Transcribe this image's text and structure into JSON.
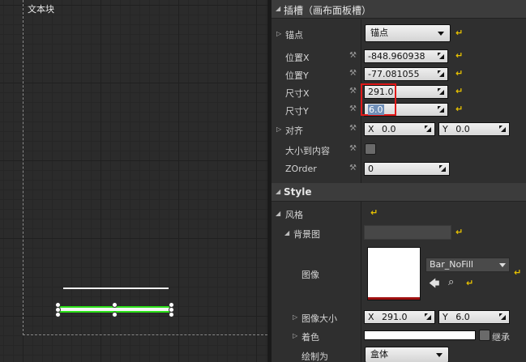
{
  "viewport": {
    "label": "文本块"
  },
  "panel": {
    "section_slot": {
      "title": "插槽（画布面板槽）"
    },
    "anchor": {
      "label": "锚点",
      "value": "锚点"
    },
    "pos_x": {
      "label": "位置X",
      "value": "-848.960938"
    },
    "pos_y": {
      "label": "位置Y",
      "value": "-77.081055"
    },
    "size_x": {
      "label": "尺寸X",
      "value": "291.0"
    },
    "size_y": {
      "label": "尺寸Y",
      "value": "6.0"
    },
    "alignment": {
      "label": "对齐",
      "x_prefix": "X",
      "x_value": "0.0",
      "y_prefix": "Y",
      "y_value": "0.0"
    },
    "size_to_content": {
      "label": "大小到内容"
    },
    "zorder": {
      "label": "ZOrder",
      "value": "0"
    },
    "section_style": {
      "title": "Style"
    },
    "style": {
      "label": "风格"
    },
    "background": {
      "label": "背景图"
    },
    "image": {
      "label": "图像",
      "asset": "Bar_NoFill"
    },
    "image_size": {
      "label": "图像大小",
      "x_prefix": "X",
      "x_value": "291.0",
      "y_prefix": "Y",
      "y_value": "6.0"
    },
    "tint": {
      "label": "着色",
      "inherit": "继承"
    },
    "draw_as": {
      "label": "绘制为",
      "value": "盒体"
    }
  },
  "colors": {
    "reset_arrow": "#e8c200",
    "highlight_box": "#e01818",
    "selection_green": "#2de01a"
  }
}
